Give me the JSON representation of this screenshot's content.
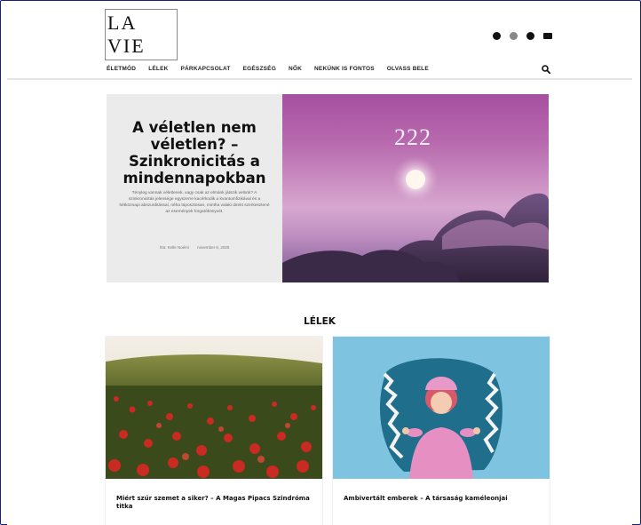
{
  "brand": {
    "logo_text": "LA VIE"
  },
  "header": {
    "social_icons": [
      "facebook-icon",
      "instagram-icon",
      "pinterest-icon",
      "mail-icon"
    ]
  },
  "nav": {
    "items": [
      {
        "label": "ÉLETMÓD"
      },
      {
        "label": "LÉLEK"
      },
      {
        "label": "PÁRKAPCSOLAT"
      },
      {
        "label": "EGÉSZSÉG"
      },
      {
        "label": "NŐK"
      },
      {
        "label": "NEKÜNK IS FONTOS"
      },
      {
        "label": "OLVASS BELE"
      }
    ]
  },
  "hero": {
    "title": "A véletlen nem véletlen? – Szinkronicitás a mindennapokban",
    "excerpt": "Tényleg vannak véletlenek, vagy csak az elmánk játszik velünk? A szinkronicitás jelensége egyszerre kacérkodik a kvantumfizikával és a hétköznapi abszurditással, néha tüposztosan, mintha valaki direkt szerkesztené az események forgatókönyvét.",
    "author": "Írta: Kelle Noémi",
    "date": "november 6, 2025",
    "image_number": "222"
  },
  "section": {
    "title": "LÉLEK",
    "cards": [
      {
        "title": "Miért szúr szemet a siker? – A Magas Pipacs Szindróma titka"
      },
      {
        "title": "Ambivertált emberek – A társaság kaméleonjai"
      }
    ]
  }
}
